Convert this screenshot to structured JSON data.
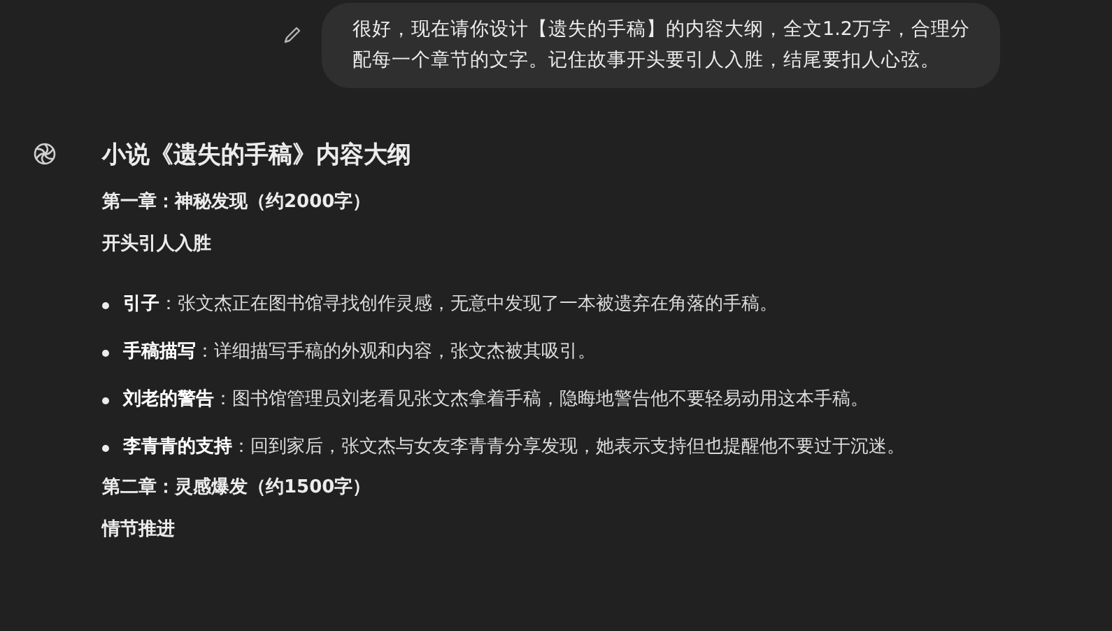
{
  "user_message": {
    "text": "很好，现在请你设计【遗失的手稿】的内容大纲，全文1.2万字，合理分配每一个章节的文字。记住故事开头要引人入胜，结尾要扣人心弦。"
  },
  "response": {
    "title": "小说《遗失的手稿》内容大纲",
    "blocks": [
      {
        "kind": "heading",
        "text": "第一章：神秘发现（约2000字）"
      },
      {
        "kind": "subheading",
        "text": "开头引人入胜"
      },
      {
        "kind": "list",
        "items": [
          "**引子**：张文杰正在图书馆寻找创作灵感，无意中发现了一本被遗弃在角落的手稿。",
          "**手稿描写**：详细描写手稿的外观和内容，张文杰被其吸引。",
          "**刘老的警告**：图书馆管理员刘老看见张文杰拿着手稿，隐晦地警告他不要轻易动用这本手稿。",
          "**李青青的支持**：回到家后，张文杰与女友李青青分享发现，她表示支持但也提醒他不要过于沉迷。"
        ]
      },
      {
        "kind": "heading",
        "text": "第二章：灵感爆发（约1500字）"
      },
      {
        "kind": "subheading",
        "text": "情节推进"
      }
    ]
  }
}
